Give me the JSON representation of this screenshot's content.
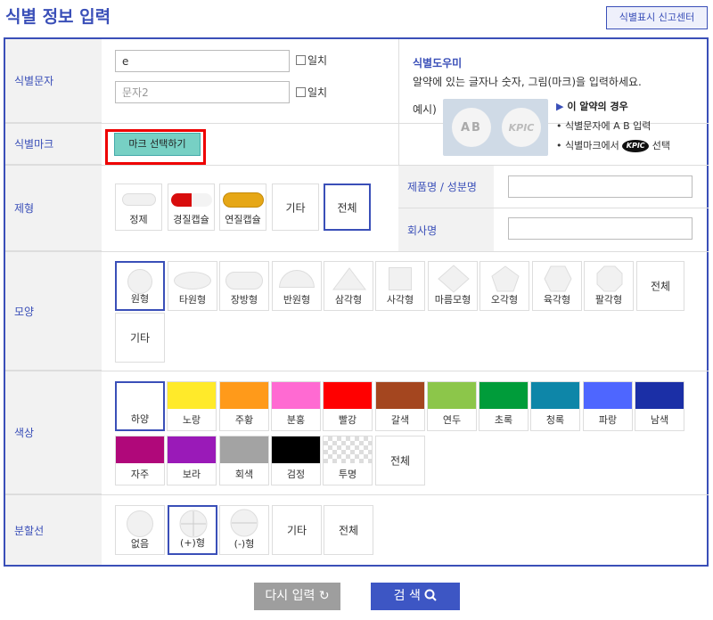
{
  "title": "식별 정보 입력",
  "report_link": "식별표시 신고센터",
  "form": {
    "id_text_label": "식별문자",
    "id_text1_value": "e",
    "id_text2_placeholder": "문자2",
    "exact_match_label": "일치",
    "mark_label": "식별마크",
    "mark_button": "마크 선택하기",
    "help": {
      "title": "식별도우미",
      "desc": "알약에 있는 글자나 숫자, 그림(마크)을 입력하세요.",
      "example_label": "예시)",
      "pill1_text": "AB",
      "pill2_text": "KPIC",
      "case_title": "이 알약의 경우",
      "case_line1": "• 식별문자에 A B 입력",
      "case_line2_prefix": "• 식별마크에서",
      "case_line2_logo": "KPIC",
      "case_line2_suffix": "선택"
    },
    "form_type": {
      "label": "제형",
      "options": [
        "정제",
        "경질캡슐",
        "연질캡슐",
        "기타",
        "전체"
      ]
    },
    "product_name_label": "제품명 / 성분명",
    "company_label": "회사명",
    "shape": {
      "label": "모양",
      "options": [
        "원형",
        "타원형",
        "장방형",
        "반원형",
        "삼각형",
        "사각형",
        "마름모형",
        "오각형",
        "육각형",
        "팔각형",
        "전체",
        "기타"
      ]
    },
    "color": {
      "label": "색상",
      "options": [
        {
          "name": "하양",
          "hex": "#ffffff"
        },
        {
          "name": "노랑",
          "hex": "#ffea2a"
        },
        {
          "name": "주황",
          "hex": "#ff9a1a"
        },
        {
          "name": "분홍",
          "hex": "#ff6ad2"
        },
        {
          "name": "빨강",
          "hex": "#ff0000"
        },
        {
          "name": "갈색",
          "hex": "#a4461f"
        },
        {
          "name": "연두",
          "hex": "#8cc64a"
        },
        {
          "name": "초록",
          "hex": "#009c3a"
        },
        {
          "name": "청록",
          "hex": "#0e86a8"
        },
        {
          "name": "파랑",
          "hex": "#4e66ff"
        },
        {
          "name": "남색",
          "hex": "#1b2fa6"
        },
        {
          "name": "자주",
          "hex": "#b0087a"
        },
        {
          "name": "보라",
          "hex": "#9a1ab8"
        },
        {
          "name": "회색",
          "hex": "#a3a3a3"
        },
        {
          "name": "검정",
          "hex": "#000000"
        },
        {
          "name": "투명",
          "hex": "transparent"
        },
        {
          "name": "전체",
          "hex": ""
        }
      ]
    },
    "score_line": {
      "label": "분할선",
      "options": [
        "없음",
        "(+)형",
        "(-)형",
        "기타",
        "전체"
      ]
    }
  },
  "buttons": {
    "reset": "다시 입력",
    "search": "검 색"
  }
}
